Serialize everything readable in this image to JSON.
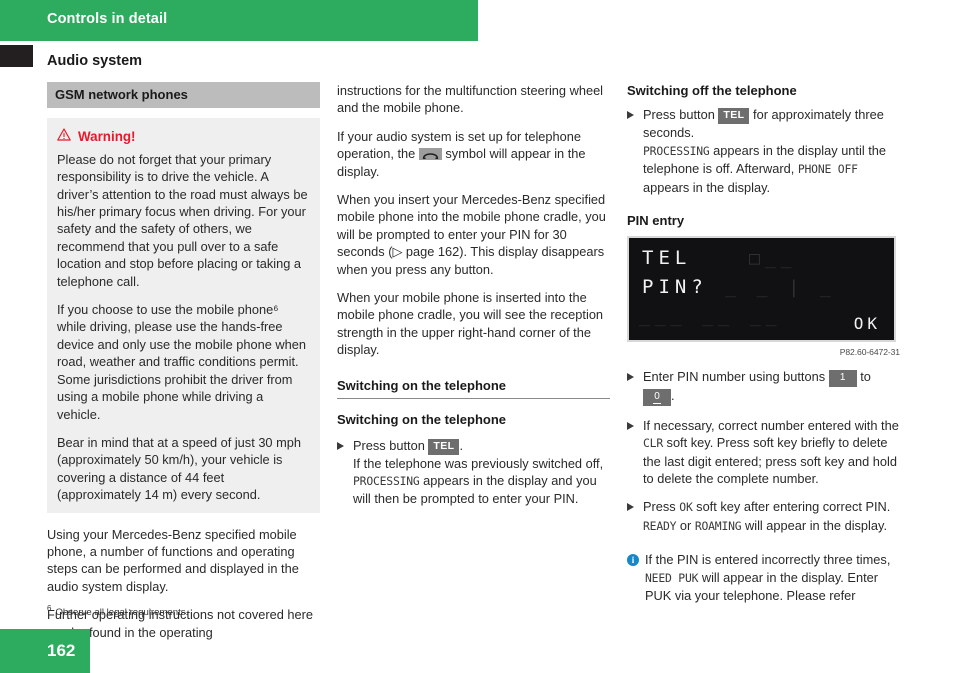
{
  "header": {
    "chapter": "Controls in detail",
    "section": "Audio system"
  },
  "page": {
    "number": "162",
    "footnote_marker": "6",
    "footnote_text": "Observe all legal requirements."
  },
  "column_left": {
    "subsection_bar": "GSM network phones",
    "warning": {
      "title": "Warning!",
      "icon": "warning-triangle-icon",
      "color": "#e8192c",
      "paragraphs": [
        "Please do not forget that your primary responsibility is to drive the vehicle. A driver’s attention to the road must always be his/her primary focus when driving. For your safety and the safety of others, we recommend that you pull over to a safe location and stop before placing or taking a telephone call.",
        "If you choose to use the mobile phone⁶ while driving, please use the hands-free device and only use the mobile phone when road, weather and traffic conditions permit. Some jurisdictions prohibit the driver from using a mobile phone while driving a vehicle.",
        "Bear in mind that at a speed of just 30 mph (approximately 50 km/h), your vehicle is covering a distance of 44 feet (approximately 14 m) every second."
      ]
    },
    "paragraphs": [
      "Using your Mercedes-Benz specified mobile phone, a number of functions and operating steps can be performed and displayed in the audio system display.",
      "Further operating instructions not covered here can be found in the operating"
    ]
  },
  "column_middle": {
    "p1": "instructions for the multifunction steering wheel and the mobile phone.",
    "p2_a": "If your audio system is set up for telephone operation, the",
    "p2_b": "symbol will appear in the display.",
    "phone_symbol_name": "telephone-handset-icon",
    "p3": "When you insert your Mercedes-Benz specified mobile phone into the mobile phone cradle, you will be prompted to enter your PIN for 30 seconds (▷ page 162). This display disappears when you press any button.",
    "p4": "When your mobile phone is inserted into the mobile phone cradle, you will see the reception strength in the upper right-hand corner of the display.",
    "heading_rule": "Switching on the telephone",
    "heading_plain": "Switching on the telephone",
    "step": {
      "lead": "Press button",
      "key": "TEL",
      "after_key": ".",
      "body_a": "If the telephone was previously switched off,",
      "display_word": "PROCESSING",
      "body_b": "appears in the display and you will then be prompted to enter your PIN."
    }
  },
  "column_right": {
    "heading_off": "Switching off the telephone",
    "step_off": {
      "lead": "Press button",
      "key": "TEL",
      "after_key": "for approximately three seconds.",
      "display_word_1": "PROCESSING",
      "body_a": "appears in the display until the telephone is off. Afterward,",
      "display_word_2": "PHONE OFF",
      "body_b": "appears in the display."
    },
    "heading_pin": "PIN entry",
    "figure": {
      "line1": "TEL",
      "line2": "PIN?",
      "softkey": "OK",
      "code": "P82.60-6472-31"
    },
    "step_enter": {
      "lead": "Enter PIN number using buttons",
      "key_from": "1",
      "middle": "to",
      "key_to": "0",
      "after": "."
    },
    "step_correct": {
      "text_a": "If necessary, correct number entered with the",
      "display_word": "CLR",
      "text_b": "soft key. Press soft key briefly to delete the last digit entered; press soft key and hold to delete the complete number."
    },
    "step_ok": {
      "text_a": "Press",
      "display_word_1": "OK",
      "text_b": "soft key after entering correct PIN.",
      "display_word_2": "READY",
      "text_c": "or",
      "display_word_3": "ROAMING",
      "text_d": "will appear in the display."
    },
    "note": {
      "icon": "info-circle-icon",
      "icon_color": "#1787c8",
      "text_a": "If the PIN is entered incorrectly three times,",
      "display_word": "NEED PUK",
      "text_b": "will appear in the display. Enter PUK via your telephone. Please refer"
    }
  }
}
